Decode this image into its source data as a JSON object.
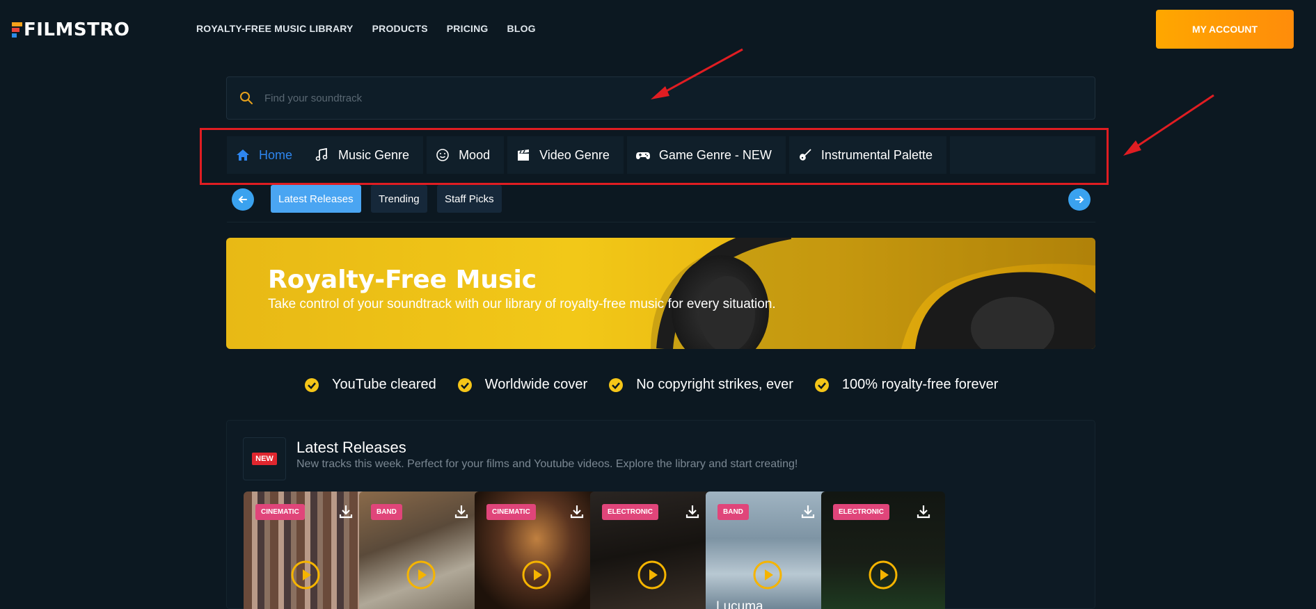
{
  "header": {
    "logo": "FILMSTRO",
    "nav": [
      "ROYALTY-FREE MUSIC LIBRARY",
      "PRODUCTS",
      "PRICING",
      "BLOG"
    ],
    "account_label": "MY ACCOUNT"
  },
  "search": {
    "placeholder": "Find your soundtrack",
    "value": ""
  },
  "categories": [
    {
      "label": "Home",
      "icon": "home-icon",
      "active": true
    },
    {
      "label": "Music Genre",
      "icon": "music-note-icon"
    },
    {
      "label": "Mood",
      "icon": "smiley-icon"
    },
    {
      "label": "Video Genre",
      "icon": "clapperboard-icon"
    },
    {
      "label": "Game Genre - NEW",
      "icon": "gamepad-icon"
    },
    {
      "label": "Instrumental Palette",
      "icon": "guitar-icon"
    }
  ],
  "subtabs": [
    {
      "label": "Latest Releases",
      "active": true
    },
    {
      "label": "Trending"
    },
    {
      "label": "Staff Picks"
    }
  ],
  "hero": {
    "title": "Royalty-Free Music",
    "subtitle": "Take control of your soundtrack with our library of royalty-free music for every situation."
  },
  "features": [
    "YouTube cleared",
    "Worldwide cover",
    "No copyright strikes, ever",
    "100% royalty-free forever"
  ],
  "latest": {
    "badge": "NEW",
    "title": "Latest Releases",
    "subtitle": "New tracks this week. Perfect for your films and Youtube videos. Explore the library and start creating!",
    "cards": [
      {
        "tag": "CINEMATIC",
        "title": ""
      },
      {
        "tag": "BAND",
        "title": ""
      },
      {
        "tag": "CINEMATIC",
        "title": ""
      },
      {
        "tag": "ELECTRONIC",
        "title": ""
      },
      {
        "tag": "BAND",
        "title": "Lucuma"
      },
      {
        "tag": "ELECTRONIC",
        "title": ""
      }
    ]
  },
  "colors": {
    "background": "#0c1821",
    "accent_blue": "#2e86f0",
    "account_orange": "#ff9d05",
    "tag_pink": "#e0457a",
    "check_yellow": "#f5c518",
    "annotation_red": "#e01d22"
  }
}
